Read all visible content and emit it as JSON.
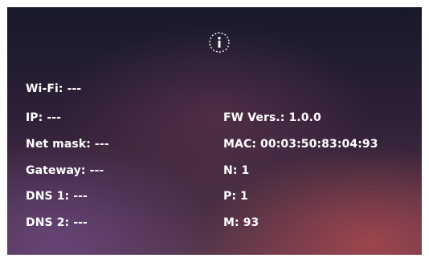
{
  "icons": {
    "info": "info-icon"
  },
  "network": {
    "wifi": "Wi-Fi: ---",
    "ip": "IP: ---",
    "net_mask": "Net mask: ---",
    "gateway": "Gateway: ---",
    "dns1": "DNS 1: ---",
    "dns2": "DNS 2: ---"
  },
  "device": {
    "fw_version": "FW Vers.: 1.0.0",
    "mac": "MAC: 00:03:50:83:04:93",
    "n": "N: 1",
    "p": "P: 1",
    "m": "M: 93"
  }
}
